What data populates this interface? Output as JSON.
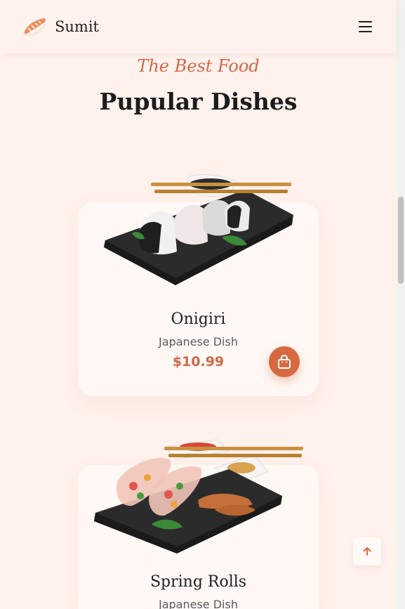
{
  "header": {
    "brand": "Sumit",
    "logo_icon": "sushi-icon",
    "menu_icon": "hamburger-menu-icon"
  },
  "section": {
    "subtitle": "The Best Food",
    "title": "Pupular Dishes"
  },
  "dishes": [
    {
      "name": "Onigiri",
      "type": "Japanese Dish",
      "price": "$10.99",
      "image_icon": "onigiri-plate-image",
      "cart_icon": "shopping-bag-icon"
    },
    {
      "name": "Spring Rolls",
      "type": "Japanese Dish",
      "image_icon": "spring-rolls-plate-image"
    }
  ],
  "colors": {
    "accent": "#d6693f",
    "background": "#fff1ec",
    "card": "#fff8f5"
  },
  "scroll_top_icon": "arrow-up-icon"
}
